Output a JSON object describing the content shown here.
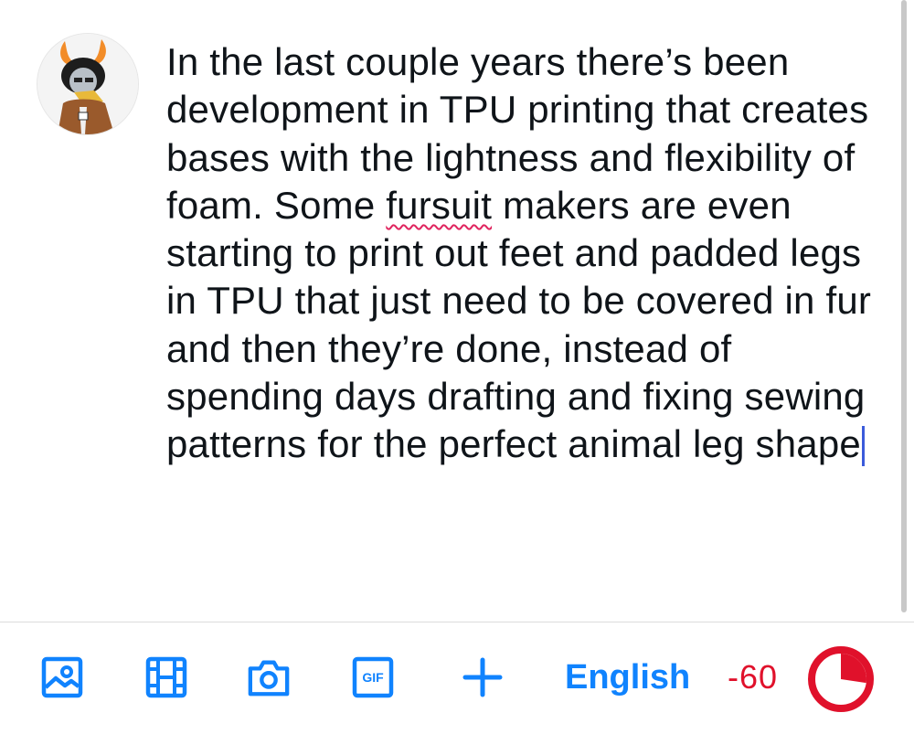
{
  "composer": {
    "avatar_label": "user avatar",
    "text_before": "In the last couple years there’s been development in TPU printing that creates bases with the lightness and flexibility of foam. Some ",
    "misspelled_word": "fursuit",
    "text_after": " makers are even starting to print out feet and padded legs in TPU that just need to be covered in fur and then they’re done, instead of spending days drafting and fixing sewing patterns for the perfect animal leg shape"
  },
  "toolbar": {
    "icons": [
      "image-icon",
      "video-icon",
      "camera-icon",
      "gif-icon",
      "plus-icon"
    ],
    "gif_label": "GIF",
    "language": "English",
    "remaining_count": "-60",
    "limit_progress": 1.0,
    "colors": {
      "accent": "#1083fe",
      "over_limit": "#e0112b"
    }
  }
}
